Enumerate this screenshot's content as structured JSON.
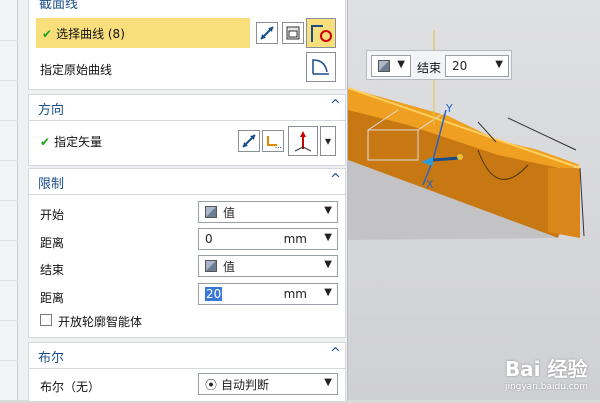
{
  "section_curve": {
    "title": "截面线",
    "select_curve": "选择曲线 (8)",
    "specify_original": "指定原始曲线"
  },
  "section_direction": {
    "title": "方向",
    "specify_vector": "指定矢量"
  },
  "section_limits": {
    "title": "限制",
    "start_label": "开始",
    "start_value": "值",
    "distance1_label": "距离",
    "distance1_value": "0",
    "distance1_unit": "mm",
    "end_label": "结束",
    "end_value": "值",
    "distance2_label": "距离",
    "distance2_value": "20",
    "distance2_unit": "mm",
    "open_profile": "开放轮廓智能体"
  },
  "section_boolean": {
    "title": "布尔",
    "boolean_label": "布尔（无）",
    "boolean_value": "自动判断"
  },
  "float_toolbar": {
    "end_label": "结束",
    "end_value": "20"
  },
  "viewport": {
    "axis_y": "Y",
    "axis_x": "X"
  },
  "watermark": {
    "brand": "Bai 经验",
    "url": "jingyan.baidu.com"
  },
  "colors": {
    "accent_selected": "#f9de7c",
    "section_title": "#1a4e8a",
    "part_orange": "#e8931a",
    "check_green": "#1aa31a"
  }
}
